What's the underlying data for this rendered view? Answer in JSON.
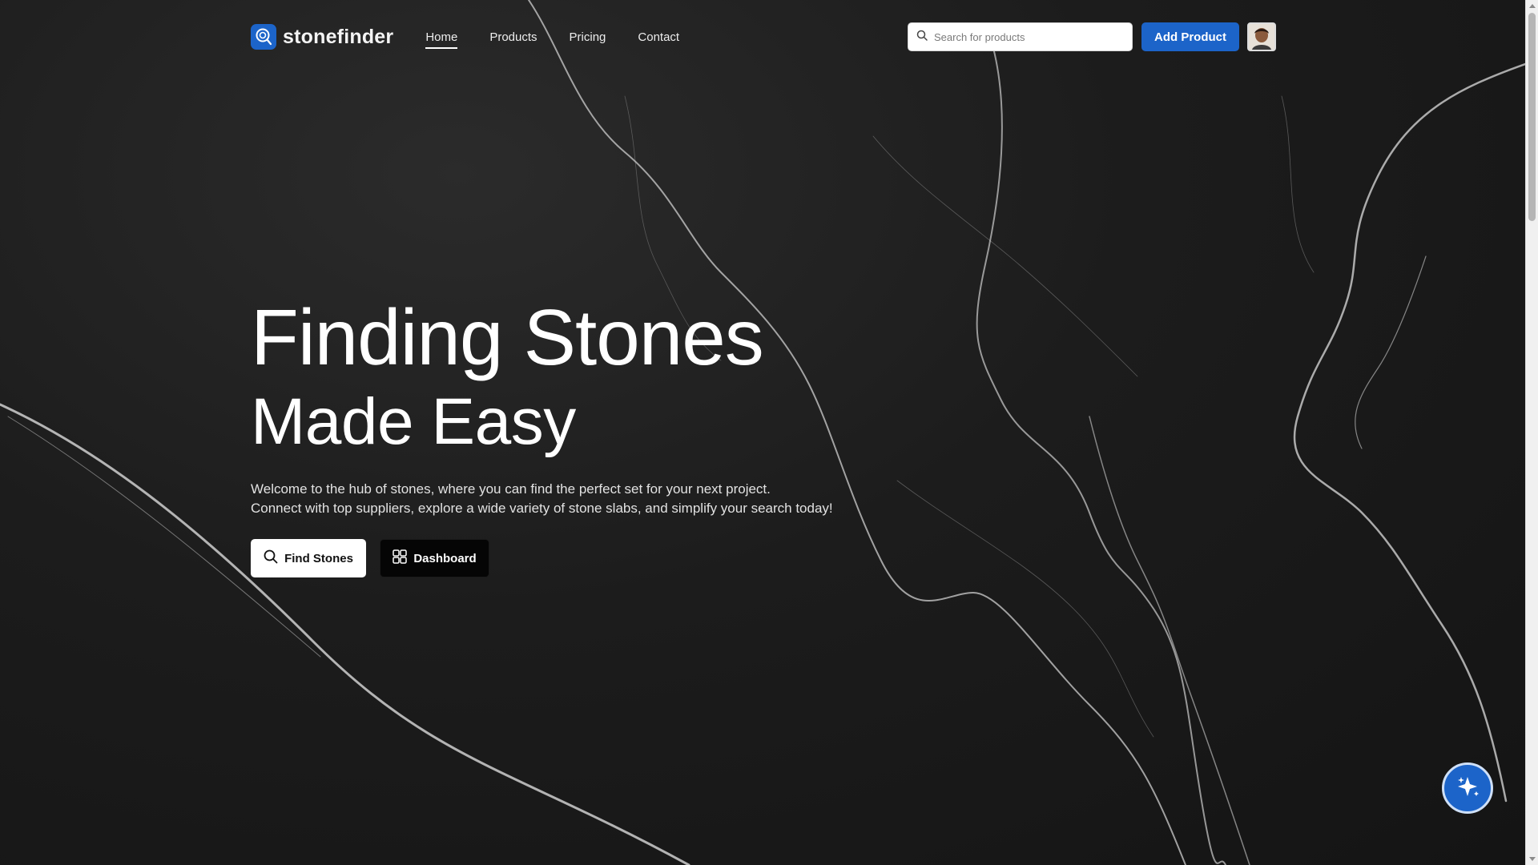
{
  "brand": {
    "name": "stonefinder",
    "accent": "#1c64c9"
  },
  "nav": {
    "items": [
      {
        "label": "Home",
        "active": true
      },
      {
        "label": "Products",
        "active": false
      },
      {
        "label": "Pricing",
        "active": false
      },
      {
        "label": "Contact",
        "active": false
      }
    ]
  },
  "search": {
    "placeholder": "Search for products",
    "value": ""
  },
  "header": {
    "add_product_label": "Add Product"
  },
  "hero": {
    "title_line1": "Finding Stones",
    "title_line2": "Made Easy",
    "description_line1": "Welcome to the hub of stones, where you can find the perfect set for your next project.",
    "description_line2": "Connect with top suppliers, explore a wide variety of stone slabs, and simplify your search today!",
    "find_label": "Find Stones",
    "dashboard_label": "Dashboard"
  },
  "icons": {
    "logo": "search-stone-icon",
    "search": "search-icon",
    "find": "search-icon",
    "dashboard": "grid-icon",
    "fab": "sparkle-icon"
  }
}
